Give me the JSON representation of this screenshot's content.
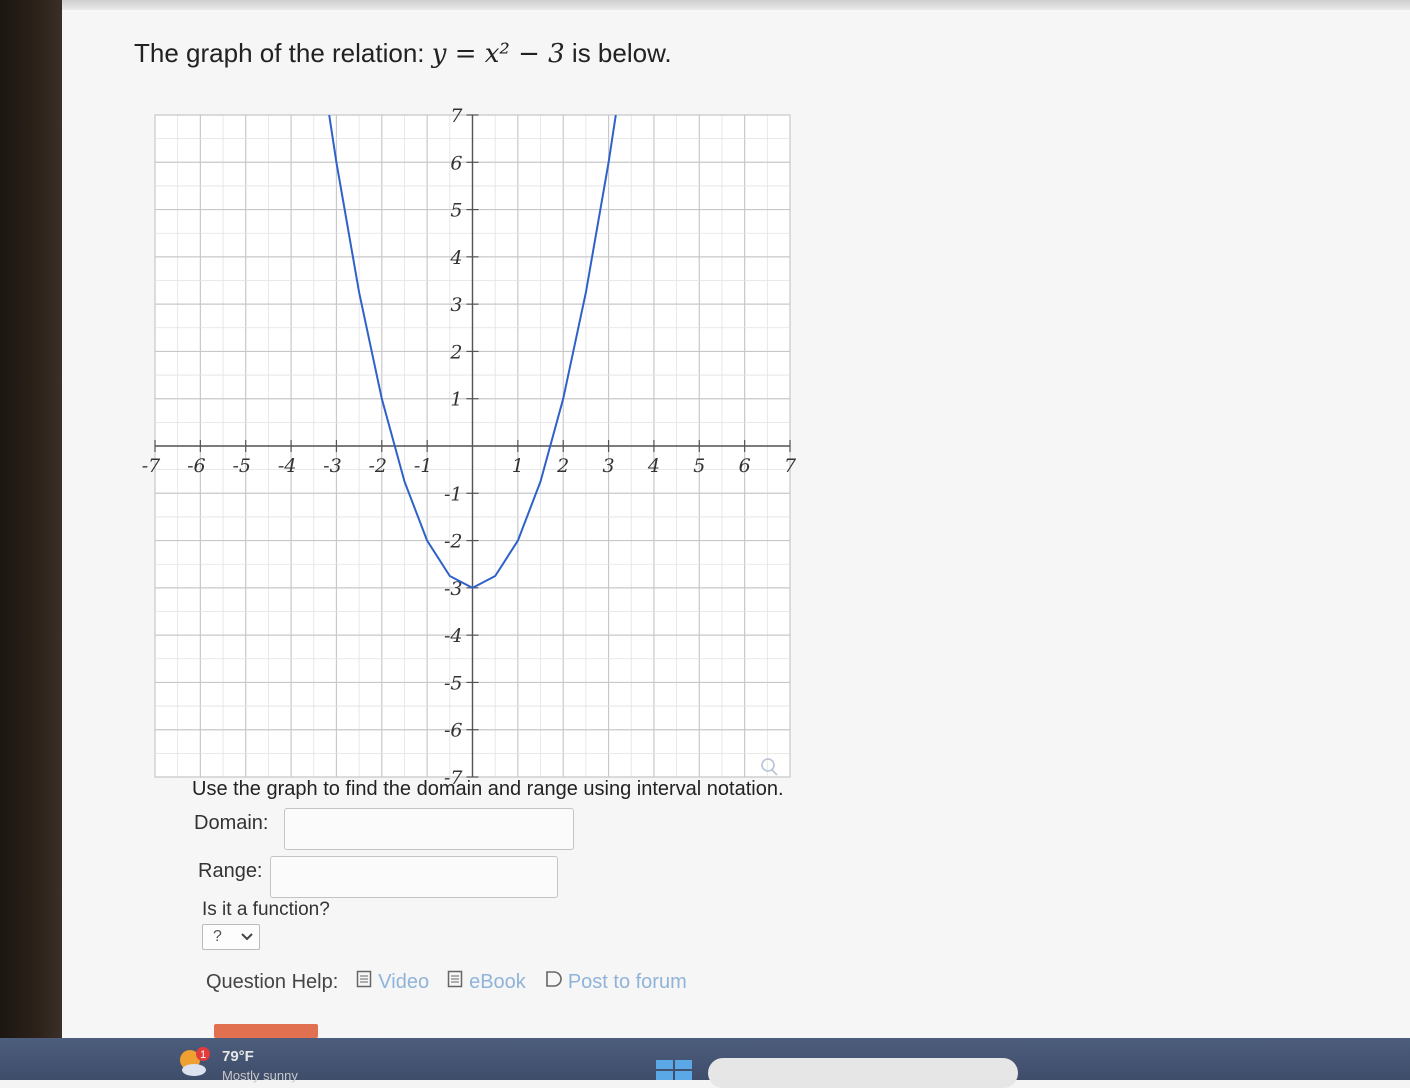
{
  "question": {
    "title_prefix": "The graph of the relation: ",
    "equation": "y = x² − 3",
    "title_suffix": " is below."
  },
  "chart_data": {
    "type": "line",
    "title": "",
    "xlabel": "",
    "ylabel": "",
    "xlim": [
      -7,
      7
    ],
    "ylim": [
      -7,
      7
    ],
    "grid": true,
    "x_ticks": [
      "-7",
      "-6",
      "-5",
      "-4",
      "-3",
      "-2",
      "-1",
      "1",
      "2",
      "3",
      "4",
      "5",
      "6",
      "7"
    ],
    "y_ticks": [
      "7",
      "6",
      "5",
      "4",
      "3",
      "2",
      "1",
      "-1",
      "-2",
      "-3",
      "-4",
      "-5",
      "-6",
      "-7"
    ],
    "series": [
      {
        "color": "#2f62c8",
        "x": [
          -3.16,
          -3,
          -2.5,
          -2,
          -1.5,
          -1,
          -0.5,
          0,
          0.5,
          1,
          1.5,
          2,
          2.5,
          3,
          3.16
        ],
        "y": [
          7,
          6,
          3.25,
          1,
          -0.75,
          -2,
          -2.75,
          -3,
          -2.75,
          -2,
          -0.75,
          1,
          3.25,
          6,
          7
        ]
      }
    ]
  },
  "instructions": "Use the graph to find the domain and range using interval notation.",
  "domain": {
    "label": "Domain:",
    "value": ""
  },
  "range": {
    "label": "Range:",
    "value": ""
  },
  "function_question": {
    "label": "Is it a function?",
    "selected": "?"
  },
  "help": {
    "label": "Question Help:",
    "video": "Video",
    "ebook": "eBook",
    "forum": "Post to forum"
  },
  "taskbar": {
    "temperature": "79°F",
    "weather": "Mostly sunny",
    "badge": "1"
  }
}
